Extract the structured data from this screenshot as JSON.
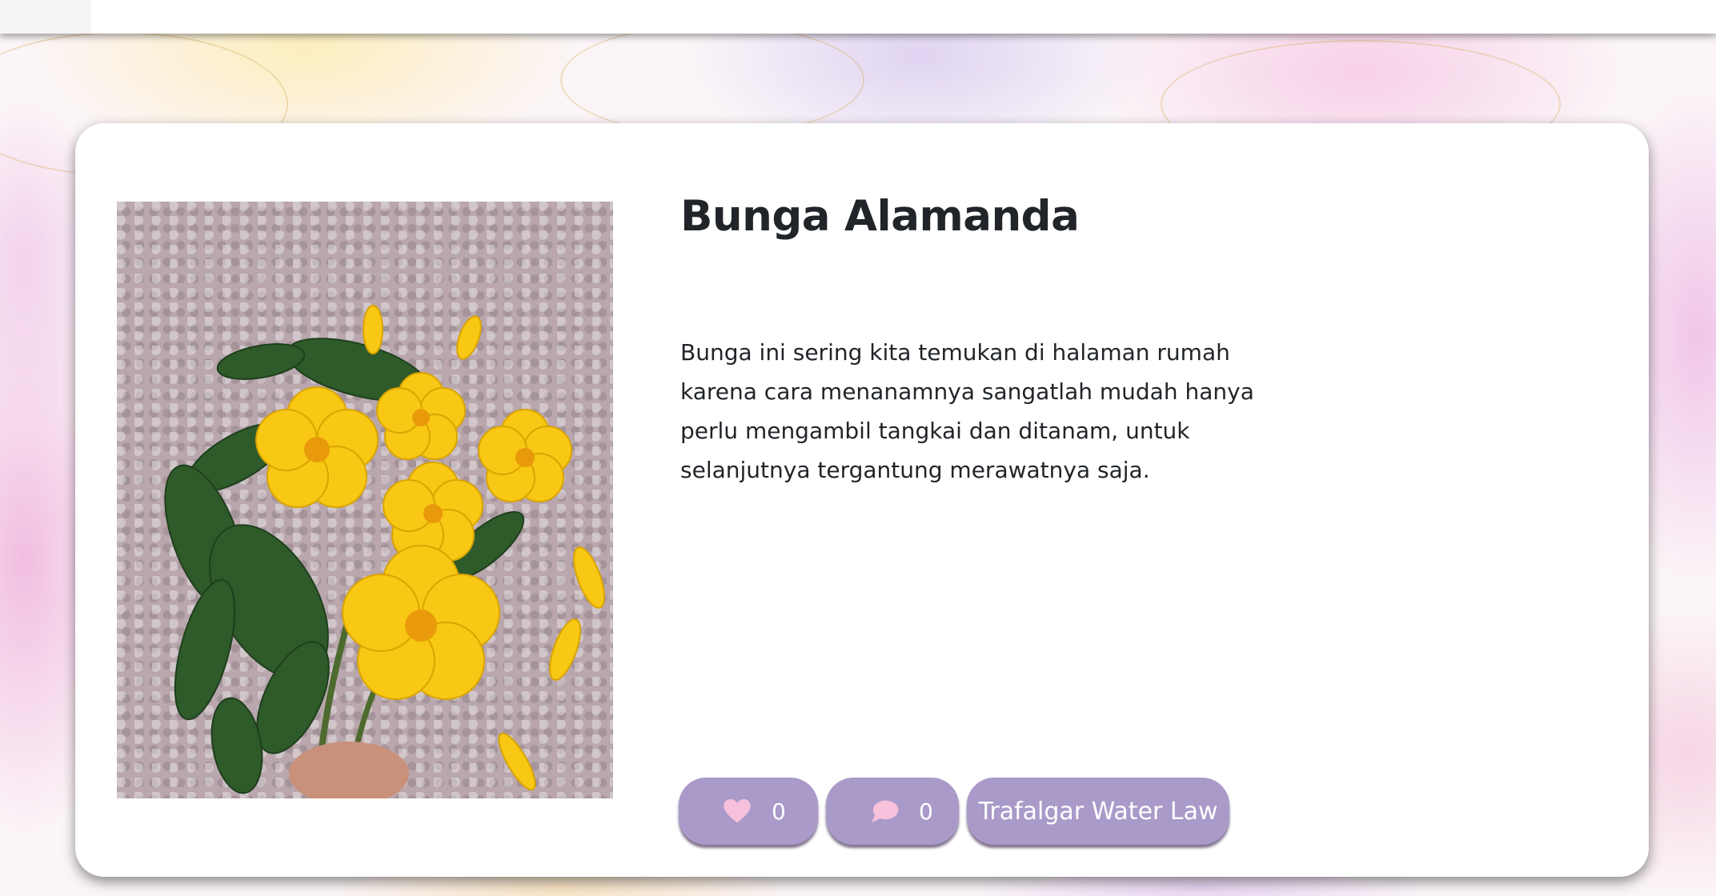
{
  "post": {
    "title": "Bunga Alamanda",
    "description": "Bunga ini sering kita temukan di halaman rumah karena cara menanamnya sangatlah mudah hanya perlu mengambil tangkai dan ditanam, untuk selanjutnya tergantung merawatnya saja.",
    "image_subject": "yellow allamanda flowers held in hand over pebble floor",
    "likes": {
      "icon": "heart-icon",
      "count": "0"
    },
    "comments": {
      "icon": "speech-bubble-icon",
      "count": "0"
    },
    "author": "Trafalgar Water Law"
  },
  "colors": {
    "accent": "#a99ac9",
    "icon_pink": "#f7c1dc",
    "text": "#212529",
    "card": "#ffffff"
  }
}
